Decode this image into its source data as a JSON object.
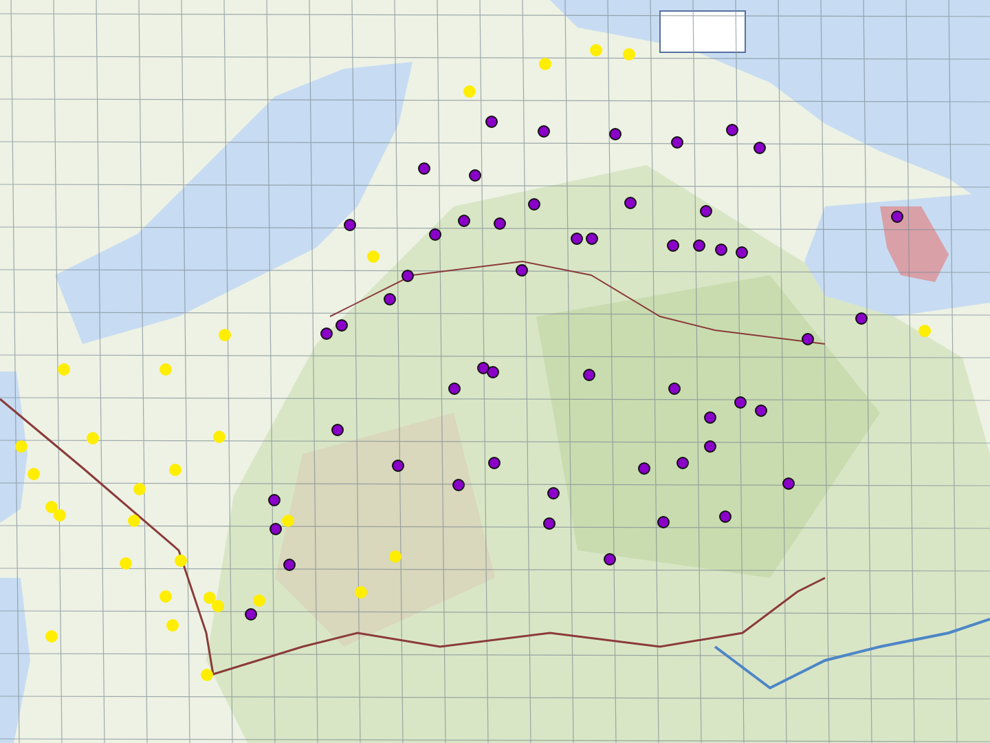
{
  "map": {
    "pins": [
      {
        "color": "#8a00c8"
      },
      {
        "color": "#8a00c8"
      },
      {
        "color": "#8a00c8"
      },
      {
        "color": "#8a00c8"
      },
      {
        "color": "#8a00c8"
      },
      {
        "color": "#8a00c8"
      },
      {
        "color": "#8a00c8"
      },
      {
        "color": "#8a00c8"
      },
      {
        "color": "#8a00c8"
      },
      {
        "color": "#8a00c8"
      },
      {
        "color": "#8a00c8"
      },
      {
        "color": "#8a00c8"
      },
      {
        "color": "#8a00c8"
      },
      {
        "color": "#8a00c8"
      },
      {
        "color": "#8a00c8"
      },
      {
        "color": "#8a00c8"
      },
      {
        "color": "#8a00c8"
      },
      {
        "color": "#8a00c8"
      },
      {
        "color": "#8a00c8"
      },
      {
        "color": "#8a00c8"
      },
      {
        "color": "#8a00c8"
      },
      {
        "color": "#8a00c8"
      },
      {
        "color": "#8a00c8"
      },
      {
        "color": "#8a00c8"
      },
      {
        "color": "#8a00c8"
      },
      {
        "color": "#8a00c8"
      },
      {
        "color": "#8a00c8"
      },
      {
        "color": "#8a00c8"
      },
      {
        "color": "#8a00c8"
      },
      {
        "color": "#8a00c8"
      },
      {
        "color": "#8a00c8"
      },
      {
        "color": "#8a00c8"
      },
      {
        "color": "#8a00c8"
      },
      {
        "color": "#8a00c8"
      },
      {
        "color": "#8a00c8"
      },
      {
        "color": "#8a00c8"
      },
      {
        "color": "#8a00c8"
      },
      {
        "color": "#8a00c8"
      },
      {
        "color": "#8a00c8"
      },
      {
        "color": "#8a00c8"
      },
      {
        "color": "#8a00c8"
      },
      {
        "color": "#8a00c8"
      },
      {
        "color": "#8a00c8"
      },
      {
        "color": "#8a00c8"
      },
      {
        "color": "#8a00c8"
      },
      {
        "color": "#8a00c8"
      },
      {
        "color": "#8a00c8"
      },
      {
        "color": "#8a00c8"
      },
      {
        "color": "#8a00c8"
      },
      {
        "color": "#8a00c8"
      },
      {
        "color": "#8a00c8"
      },
      {
        "color": "#8a00c8"
      },
      {
        "color": "#8a00c8"
      },
      {
        "color": "#8a00c8"
      },
      {
        "color": "#ffee00"
      },
      {
        "color": "#ffee00"
      },
      {
        "color": "#ffee00"
      },
      {
        "color": "#ffee00"
      },
      {
        "color": "#ffee00"
      },
      {
        "color": "#ffee00"
      },
      {
        "color": "#ffee00"
      },
      {
        "color": "#ffee00"
      },
      {
        "color": "#ffee00"
      },
      {
        "color": "#ffee00"
      },
      {
        "color": "#ffee00"
      },
      {
        "color": "#ffee00"
      },
      {
        "color": "#ffee00"
      },
      {
        "color": "#ffee00"
      },
      {
        "color": "#ffee00"
      },
      {
        "color": "#ffee00"
      },
      {
        "color": "#ffee00"
      },
      {
        "color": "#ffee00"
      },
      {
        "color": "#ffee00"
      },
      {
        "color": "#ffee00"
      },
      {
        "color": "#ffee00"
      },
      {
        "color": "#ffee00"
      },
      {
        "color": "#ffee00"
      },
      {
        "color": "#ffee00"
      },
      {
        "color": "#ffee00"
      },
      {
        "color": "#ffee00"
      },
      {
        "color": "#ffee00"
      },
      {
        "color": "#ffee00"
      },
      {
        "color": "#ffee00"
      },
      {
        "color": "#ffee00"
      }
    ]
  }
}
